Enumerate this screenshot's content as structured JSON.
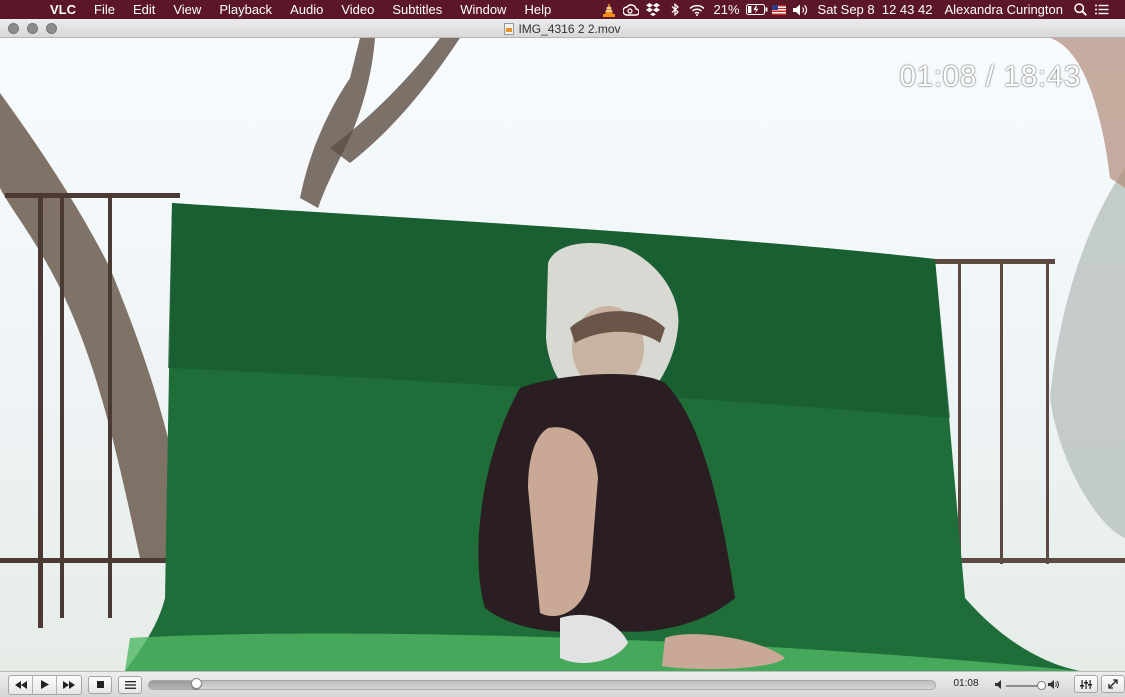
{
  "menubar": {
    "apple_icon": "apple-logo-icon",
    "app_name": "VLC",
    "items": [
      "File",
      "Edit",
      "View",
      "Playback",
      "Audio",
      "Video",
      "Subtitles",
      "Window",
      "Help"
    ],
    "status_icons": [
      "vlc-cone-icon",
      "creative-cloud-icon",
      "dropbox-icon",
      "bluetooth-icon",
      "wifi-icon"
    ],
    "battery_percent": "21%",
    "datetime": "Sat Sep 8  12 43 42",
    "user_name": "Alexandra Curington"
  },
  "window": {
    "title": "IMG_4316 2 2.mov"
  },
  "video": {
    "time_overlay": "01:08 / 18:43"
  },
  "controls": {
    "elapsed_time": "01:08",
    "progress_fraction": 0.0604,
    "volume_fraction": 0.88
  },
  "colors": {
    "menubar_bg": "#5b1727",
    "turf_green": "#1f6e39"
  }
}
